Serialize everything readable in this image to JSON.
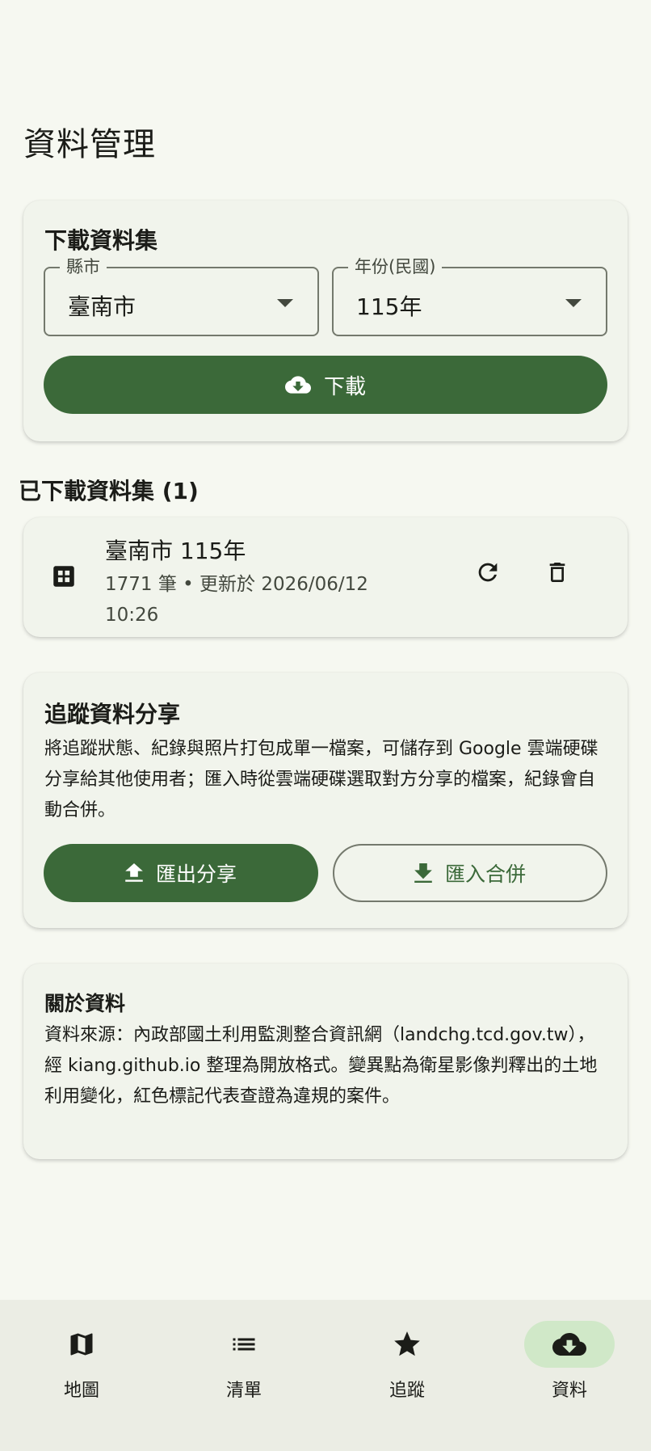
{
  "page": {
    "title": "資料管理"
  },
  "download_card": {
    "heading": "下載資料集",
    "county": {
      "label": "縣市",
      "value": "臺南市"
    },
    "year": {
      "label": "年份(民國)",
      "value": "115年"
    },
    "download_label": "下載"
  },
  "downloaded": {
    "title": "已下載資料集 (1)",
    "items": [
      {
        "name": "臺南市 115年",
        "meta": "1771 筆 • 更新於 2026/06/12 10:26"
      }
    ]
  },
  "share_card": {
    "heading": "追蹤資料分享",
    "description": "將追蹤狀態、紀錄與照片打包成單一檔案，可儲存到 Google 雲端硬碟分享給其他使用者；匯入時從雲端硬碟選取對方分享的檔案，紀錄會自動合併。",
    "export_label": "匯出分享",
    "import_label": "匯入合併"
  },
  "about_card": {
    "heading": "關於資料",
    "text": "資料來源：內政部國土利用監測整合資訊網（landchg.tcd.gov.tw），經 kiang.github.io 整理為開放格式。變異點為衛星影像判釋出的土地利用變化，紅色標記代表查證為違規的案件。"
  },
  "nav": {
    "items": [
      {
        "label": "地圖",
        "icon": "map-icon"
      },
      {
        "label": "清單",
        "icon": "list-icon"
      },
      {
        "label": "追蹤",
        "icon": "star-icon"
      },
      {
        "label": "資料",
        "icon": "cloud-download-icon",
        "active": true
      }
    ]
  },
  "colors": {
    "primary": "#3b6939",
    "background": "#f6f8f1",
    "card": "#f1f4ec",
    "nav_active": "#d0e8c8"
  }
}
